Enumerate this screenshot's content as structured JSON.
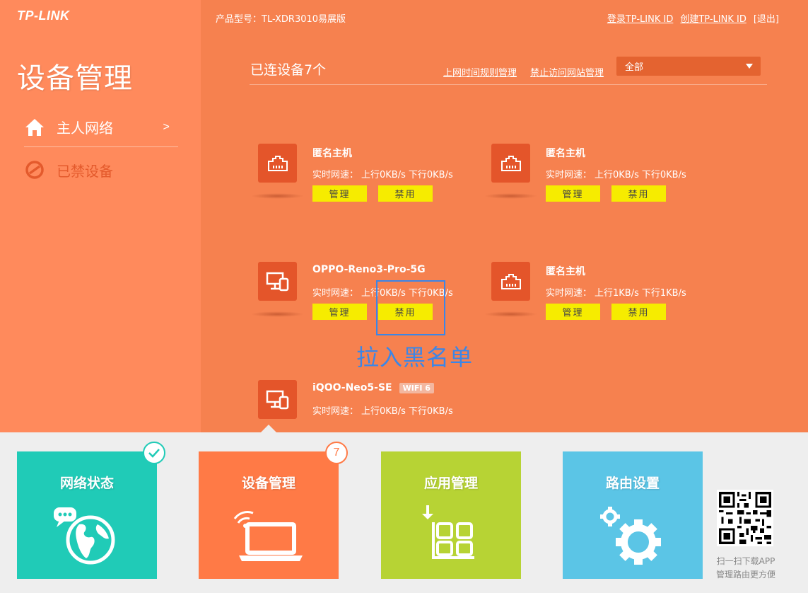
{
  "brand": {
    "logo_text": "TP-LINK"
  },
  "header": {
    "product_model": "产品型号：TL-XDR3010易展版",
    "links": [
      "登录TP-LINK ID",
      "创建TP-LINK ID"
    ],
    "logout": "[退出]"
  },
  "sidebar": {
    "title": "设备管理",
    "items": [
      {
        "label": "主人网络",
        "arrow": ">",
        "icon": "home-icon"
      },
      {
        "label": "已禁设备",
        "icon": "block-icon"
      }
    ]
  },
  "main": {
    "connected_count": "已连设备7个",
    "rule_links": [
      "上网时间规则管理",
      "禁止访问网站管理"
    ],
    "filter_value": "全部"
  },
  "devices": [
    {
      "name": "匿名主机",
      "icon": "ethernet-icon",
      "speed_label": "实时网速：",
      "up": "上行0KB/s",
      "down": "下行0KB/s",
      "manage": "管理",
      "block": "禁用"
    },
    {
      "name": "匿名主机",
      "icon": "ethernet-icon",
      "speed_label": "实时网速：",
      "up": "上行0KB/s",
      "down": "下行0KB/s",
      "manage": "管理",
      "block": "禁用"
    },
    {
      "name": "OPPO-Reno3-Pro-5G",
      "icon": "devices-icon",
      "speed_label": "实时网速：",
      "up": "上行0KB/s",
      "down": "下行0KB/s",
      "manage": "管理",
      "block": "禁用"
    },
    {
      "name": "匿名主机",
      "icon": "ethernet-icon",
      "speed_label": "实时网速：",
      "up": "上行1KB/s",
      "down": "下行1KB/s",
      "manage": "管理",
      "block": "禁用"
    },
    {
      "name": "iQOO-Neo5-SE",
      "badge": "WIFI 6",
      "icon": "devices-icon",
      "speed_label": "实时网速：",
      "up": "上行0KB/s",
      "down": "下行0KB/s"
    }
  ],
  "annotation": {
    "text": "拉入黑名单",
    "color": "#3a86e8"
  },
  "tiles": [
    {
      "label": "网络状态",
      "icon": "globe-icon",
      "color": "#20cbb7"
    },
    {
      "label": "设备管理",
      "icon": "laptop-wifi-icon",
      "color": "#ff7a46",
      "count": "7"
    },
    {
      "label": "应用管理",
      "icon": "apps-grid-icon",
      "color": "#b7d334"
    },
    {
      "label": "路由设置",
      "icon": "gear-icon",
      "color": "#5bc5e6"
    }
  ],
  "qr": {
    "caption_line1": "扫一扫下载APP",
    "caption_line2": "管理路由更方便"
  }
}
